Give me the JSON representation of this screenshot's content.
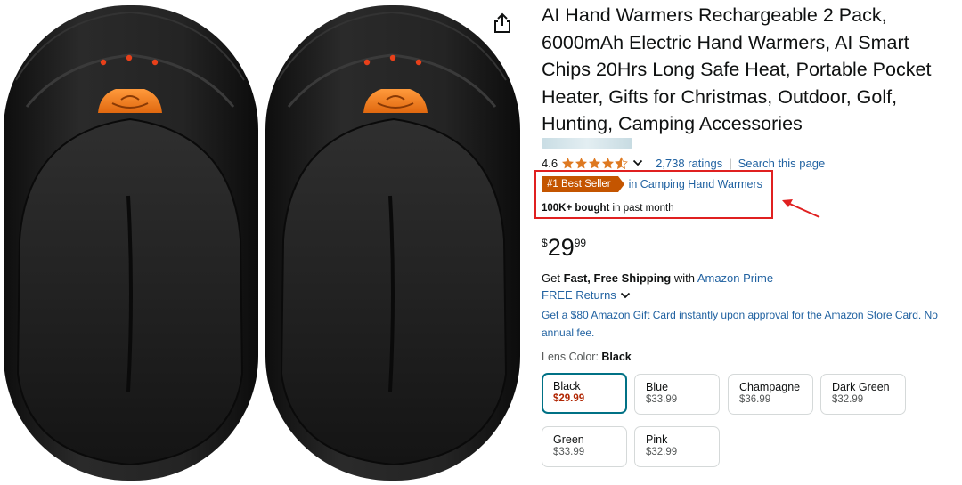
{
  "product": {
    "title": "AI Hand Warmers Rechargeable 2 Pack, 6000mAh Electric Hand Warmers, AI Smart Chips 20Hrs Long Safe Heat, Portable Pocket Heater, Gifts for Christmas, Outdoor, Golf, Hunting, Camping Accessories",
    "image_alt": "Two black rechargeable hand warmers with orange buttons"
  },
  "rating": {
    "value": "4.6",
    "stars_fill": 0.9,
    "ratings_text": "2,738 ratings",
    "separator": "|",
    "search_text": "Search this page"
  },
  "best_seller": {
    "badge": "#1 Best Seller",
    "category": "in Camping Hand Warmers",
    "bought_bold": "100K+ bought",
    "bought_rest": " in past month"
  },
  "price": {
    "symbol": "$",
    "whole": "29",
    "fraction": "99"
  },
  "shipping": {
    "prefix": "Get ",
    "bold": "Fast, Free Shipping",
    "middle": " with ",
    "link": "Amazon Prime",
    "returns": "FREE Returns",
    "gift_offer": "Get a $80 Amazon Gift Card instantly upon approval for the Amazon Store Card. No annual fee."
  },
  "variant": {
    "label": "Lens Color: ",
    "selected": "Black",
    "options": [
      {
        "name": "Black",
        "price": "$29.99"
      },
      {
        "name": "Blue",
        "price": "$33.99"
      },
      {
        "name": "Champagne",
        "price": "$36.99"
      },
      {
        "name": "Dark Green",
        "price": "$32.99"
      },
      {
        "name": "Green",
        "price": "$33.99"
      },
      {
        "name": "Pink",
        "price": "$32.99"
      }
    ]
  },
  "icons": {
    "share": "share-icon",
    "star": "star-icon",
    "chevron": "chevron-down-icon",
    "annotation": "red-arrow-annotation"
  },
  "colors": {
    "link": "#2162a1",
    "best_seller_badge": "#c45500",
    "star": "#de7921",
    "annotation_red": "#e02020",
    "selected_border": "#007185",
    "price_red": "#b12704",
    "warmer_body": "#1c1c1c",
    "warmer_button": "#f07a1f"
  }
}
